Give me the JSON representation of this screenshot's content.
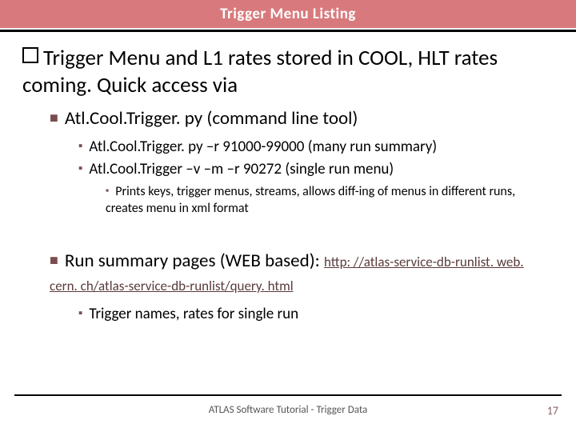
{
  "header": {
    "title": "Trigger Menu Listing"
  },
  "main": {
    "level1": "Trigger Menu and L1 rates stored in COOL, HLT rates coming. Quick access via",
    "tool": {
      "label": "Atl.Cool.Trigger. py (command line tool)",
      "examples": [
        "Atl.Cool.Trigger. py –r 91000-99000 (many run summary)",
        "Atl.Cool.Trigger –v –m –r 90272 (single run menu)"
      ],
      "note": "Prints keys, trigger menus, streams, allows diff-ing of menus in different runs, creates menu in xml format"
    },
    "web": {
      "label": "Run summary pages (WEB based): ",
      "url": "http: //atlas-service-db-runlist. web. cern. ch/atlas-service-db-runlist/query. html",
      "note": "Trigger names, rates for single run"
    }
  },
  "footer": {
    "text": "ATLAS Software Tutorial - Trigger Data",
    "page": "17"
  }
}
